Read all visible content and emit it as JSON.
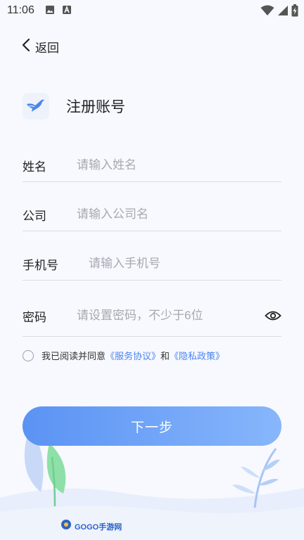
{
  "status_bar": {
    "time": "11:06",
    "icons_left": [
      "image-icon",
      "text-icon"
    ],
    "icons_right": [
      "wifi-icon",
      "signal-icon",
      "battery-icon"
    ]
  },
  "nav": {
    "back_label": "返回"
  },
  "header": {
    "title": "注册账号",
    "logo": "bird-logo-icon"
  },
  "form": {
    "name": {
      "label": "姓名",
      "placeholder": "请输入姓名",
      "value": ""
    },
    "company": {
      "label": "公司",
      "placeholder": "请输入公司名",
      "value": ""
    },
    "phone": {
      "label": "手机号",
      "placeholder": "请输入手机号",
      "value": ""
    },
    "password": {
      "label": "密码",
      "placeholder": "请设置密码，不少于6位",
      "value": ""
    }
  },
  "agreement": {
    "checked": false,
    "prefix": "我已阅读并同意",
    "service_link": "《服务协议》",
    "and": "和",
    "privacy_link": "《隐私政策》"
  },
  "next_button": {
    "label": "下一步"
  },
  "watermark": {
    "text": "GOGO手游网"
  },
  "colors": {
    "accent": "#4b84f0",
    "button_gradient_start": "#5b93f4",
    "button_gradient_end": "#87b6fb",
    "background": "#f7f9ff"
  }
}
